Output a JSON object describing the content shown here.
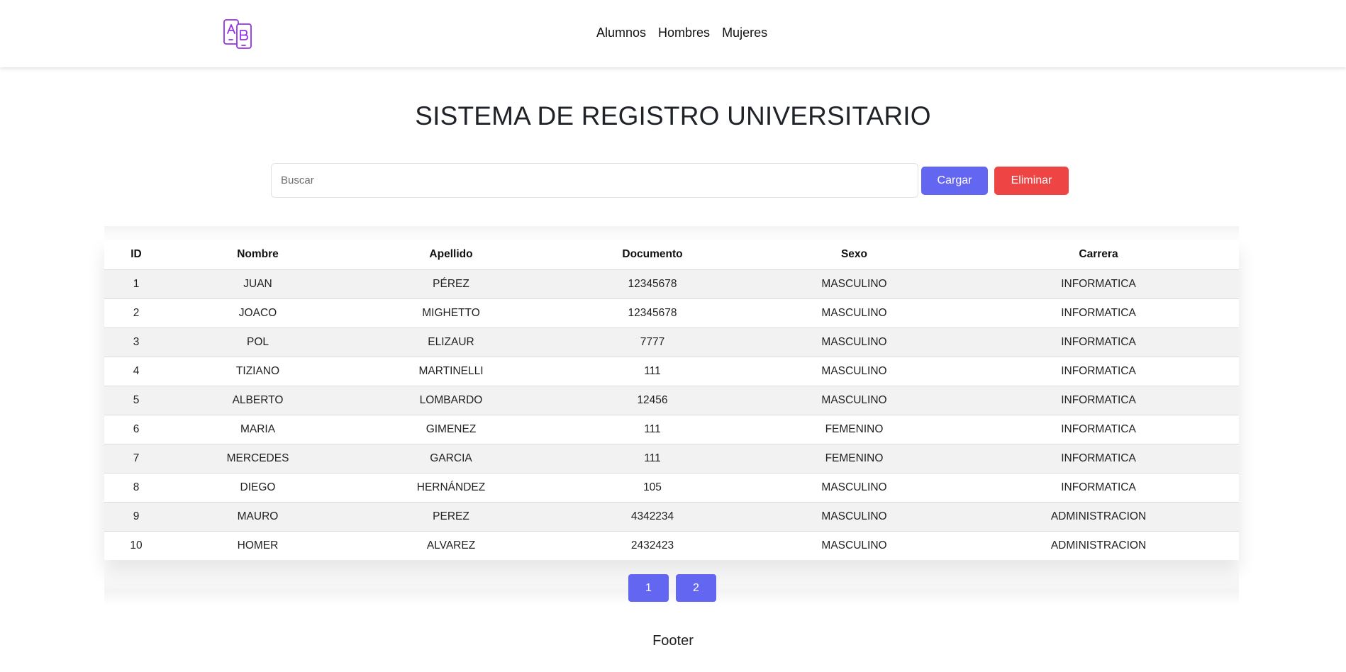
{
  "navbar": {
    "logo_icon": "ab-language-icon",
    "links": [
      {
        "label": "Alumnos"
      },
      {
        "label": "Hombres"
      },
      {
        "label": "Mujeres"
      }
    ]
  },
  "main": {
    "title": "SISTEMA DE REGISTRO UNIVERSITARIO",
    "search": {
      "placeholder": "Buscar",
      "value": ""
    },
    "buttons": {
      "load_label": "Cargar",
      "delete_label": "Eliminar"
    }
  },
  "table": {
    "headers": [
      "ID",
      "Nombre",
      "Apellido",
      "Documento",
      "Sexo",
      "Carrera"
    ],
    "rows": [
      [
        "1",
        "JUAN",
        "PÉREZ",
        "12345678",
        "MASCULINO",
        "INFORMATICA"
      ],
      [
        "2",
        "JOACO",
        "MIGHETTO",
        "12345678",
        "MASCULINO",
        "INFORMATICA"
      ],
      [
        "3",
        "POL",
        "ELIZAUR",
        "7777",
        "MASCULINO",
        "INFORMATICA"
      ],
      [
        "4",
        "TIZIANO",
        "MARTINELLI",
        "111",
        "MASCULINO",
        "INFORMATICA"
      ],
      [
        "5",
        "ALBERTO",
        "LOMBARDO",
        "12456",
        "MASCULINO",
        "INFORMATICA"
      ],
      [
        "6",
        "MARIA",
        "GIMENEZ",
        "111",
        "FEMENINO",
        "INFORMATICA"
      ],
      [
        "7",
        "MERCEDES",
        "GARCIA",
        "111",
        "FEMENINO",
        "INFORMATICA"
      ],
      [
        "8",
        "DIEGO",
        "HERNÁNDEZ",
        "105",
        "MASCULINO",
        "INFORMATICA"
      ],
      [
        "9",
        "MAURO",
        "PEREZ",
        "4342234",
        "MASCULINO",
        "ADMINISTRACION"
      ],
      [
        "10",
        "HOMER",
        "ALVAREZ",
        "2432423",
        "MASCULINO",
        "ADMINISTRACION"
      ]
    ]
  },
  "pagination": {
    "pages": [
      "1",
      "2"
    ]
  },
  "footer": {
    "text": "Footer"
  },
  "colors": {
    "primary": "#6366f1",
    "danger": "#ef4444",
    "logo": "#9333ea",
    "row_stripe": "#f2f2f2"
  }
}
